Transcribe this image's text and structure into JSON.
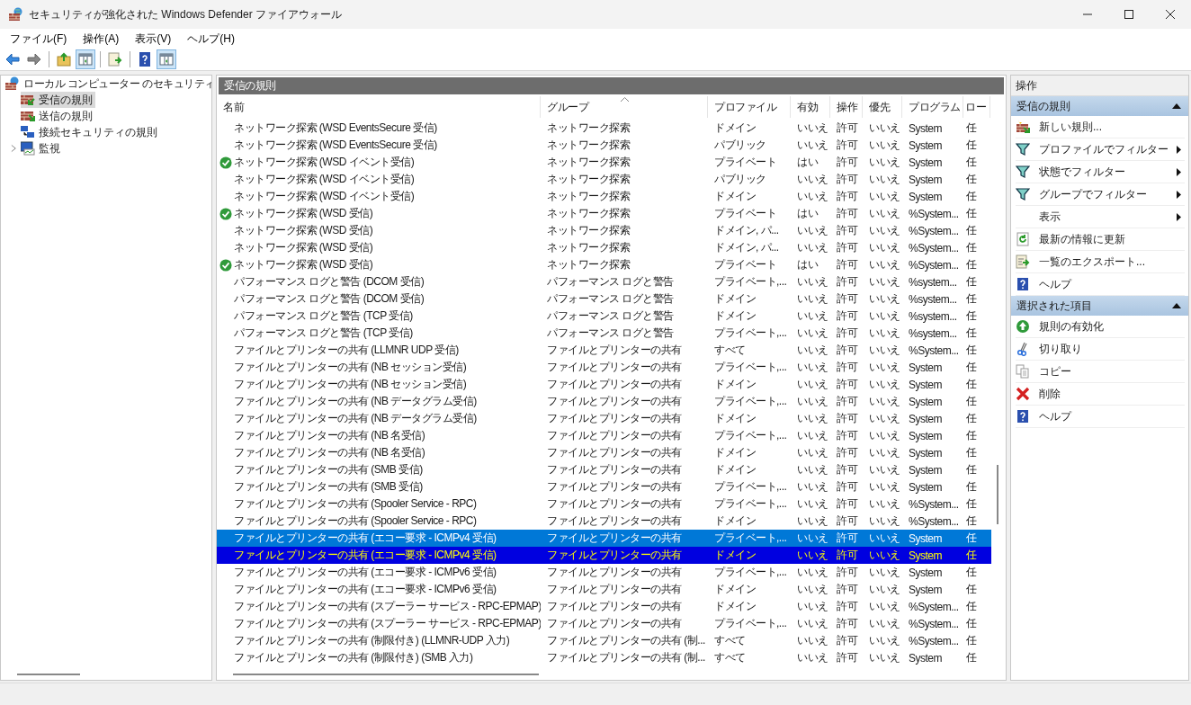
{
  "window": {
    "title": "セキュリティが強化された Windows Defender ファイアウォール"
  },
  "menu": [
    "ファイル(F)",
    "操作(A)",
    "表示(V)",
    "ヘルプ(H)"
  ],
  "toolbar": [
    {
      "kind": "back",
      "pressed": false
    },
    {
      "kind": "forward",
      "pressed": false
    },
    {
      "kind": "sep",
      "pressed": false
    },
    {
      "kind": "up",
      "pressed": false
    },
    {
      "kind": "tree",
      "pressed": true
    },
    {
      "kind": "sep",
      "pressed": false
    },
    {
      "kind": "export",
      "pressed": false
    },
    {
      "kind": "sep",
      "pressed": false
    },
    {
      "kind": "help",
      "pressed": false
    },
    {
      "kind": "pane",
      "pressed": true
    }
  ],
  "tree": {
    "root": "ローカル コンピューター のセキュリティ",
    "children": [
      {
        "label": "受信の規則",
        "kind": "inbound",
        "selected": true,
        "expandable": false
      },
      {
        "label": "送信の規則",
        "kind": "outbound",
        "selected": false,
        "expandable": false
      },
      {
        "label": "接続セキュリティの規則",
        "kind": "connection",
        "selected": false,
        "expandable": false
      },
      {
        "label": "監視",
        "kind": "monitor",
        "selected": false,
        "expandable": true
      }
    ]
  },
  "center": {
    "title": "受信の規則",
    "columns": [
      {
        "label": "名前",
        "sorted": false
      },
      {
        "label": "グループ",
        "sorted": true
      },
      {
        "label": "プロファイル",
        "sorted": false
      },
      {
        "label": "有効",
        "sorted": false
      },
      {
        "label": "操作",
        "sorted": false
      },
      {
        "label": "優先",
        "sorted": false
      },
      {
        "label": "プログラム",
        "sorted": false
      },
      {
        "label": "ロー",
        "sorted": false
      }
    ],
    "rows": [
      {
        "active": false,
        "selected": false,
        "focused": false,
        "cells": [
          "ネットワーク探索 (WSD EventsSecure 受信)",
          "ネットワーク探索",
          "ドメイン",
          "いいえ",
          "許可",
          "いいえ",
          "System",
          "任"
        ]
      },
      {
        "active": false,
        "selected": false,
        "focused": false,
        "cells": [
          "ネットワーク探索 (WSD EventsSecure 受信)",
          "ネットワーク探索",
          "パブリック",
          "いいえ",
          "許可",
          "いいえ",
          "System",
          "任"
        ]
      },
      {
        "active": true,
        "selected": false,
        "focused": false,
        "cells": [
          "ネットワーク探索 (WSD イベント受信)",
          "ネットワーク探索",
          "プライベート",
          "はい",
          "許可",
          "いいえ",
          "System",
          "任"
        ]
      },
      {
        "active": false,
        "selected": false,
        "focused": false,
        "cells": [
          "ネットワーク探索 (WSD イベント受信)",
          "ネットワーク探索",
          "パブリック",
          "いいえ",
          "許可",
          "いいえ",
          "System",
          "任"
        ]
      },
      {
        "active": false,
        "selected": false,
        "focused": false,
        "cells": [
          "ネットワーク探索 (WSD イベント受信)",
          "ネットワーク探索",
          "ドメイン",
          "いいえ",
          "許可",
          "いいえ",
          "System",
          "任"
        ]
      },
      {
        "active": true,
        "selected": false,
        "focused": false,
        "cells": [
          "ネットワーク探索 (WSD 受信)",
          "ネットワーク探索",
          "プライベート",
          "はい",
          "許可",
          "いいえ",
          "%System...",
          "任"
        ]
      },
      {
        "active": false,
        "selected": false,
        "focused": false,
        "cells": [
          "ネットワーク探索 (WSD 受信)",
          "ネットワーク探索",
          "ドメイン, パ...",
          "いいえ",
          "許可",
          "いいえ",
          "%System...",
          "任"
        ]
      },
      {
        "active": false,
        "selected": false,
        "focused": false,
        "cells": [
          "ネットワーク探索 (WSD 受信)",
          "ネットワーク探索",
          "ドメイン, パ...",
          "いいえ",
          "許可",
          "いいえ",
          "%System...",
          "任"
        ]
      },
      {
        "active": true,
        "selected": false,
        "focused": false,
        "cells": [
          "ネットワーク探索 (WSD 受信)",
          "ネットワーク探索",
          "プライベート",
          "はい",
          "許可",
          "いいえ",
          "%System...",
          "任"
        ]
      },
      {
        "active": false,
        "selected": false,
        "focused": false,
        "cells": [
          "パフォーマンス ログと警告 (DCOM 受信)",
          "パフォーマンス ログと警告",
          "プライベート,...",
          "いいえ",
          "許可",
          "いいえ",
          "%system...",
          "任"
        ]
      },
      {
        "active": false,
        "selected": false,
        "focused": false,
        "cells": [
          "パフォーマンス ログと警告 (DCOM 受信)",
          "パフォーマンス ログと警告",
          "ドメイン",
          "いいえ",
          "許可",
          "いいえ",
          "%system...",
          "任"
        ]
      },
      {
        "active": false,
        "selected": false,
        "focused": false,
        "cells": [
          "パフォーマンス ログと警告 (TCP 受信)",
          "パフォーマンス ログと警告",
          "ドメイン",
          "いいえ",
          "許可",
          "いいえ",
          "%system...",
          "任"
        ]
      },
      {
        "active": false,
        "selected": false,
        "focused": false,
        "cells": [
          "パフォーマンス ログと警告 (TCP 受信)",
          "パフォーマンス ログと警告",
          "プライベート,...",
          "いいえ",
          "許可",
          "いいえ",
          "%system...",
          "任"
        ]
      },
      {
        "active": false,
        "selected": false,
        "focused": false,
        "cells": [
          "ファイルとプリンターの共有 (LLMNR UDP 受信)",
          "ファイルとプリンターの共有",
          "すべて",
          "いいえ",
          "許可",
          "いいえ",
          "%System...",
          "任"
        ]
      },
      {
        "active": false,
        "selected": false,
        "focused": false,
        "cells": [
          "ファイルとプリンターの共有 (NB セッション受信)",
          "ファイルとプリンターの共有",
          "プライベート,...",
          "いいえ",
          "許可",
          "いいえ",
          "System",
          "任"
        ]
      },
      {
        "active": false,
        "selected": false,
        "focused": false,
        "cells": [
          "ファイルとプリンターの共有 (NB セッション受信)",
          "ファイルとプリンターの共有",
          "ドメイン",
          "いいえ",
          "許可",
          "いいえ",
          "System",
          "任"
        ]
      },
      {
        "active": false,
        "selected": false,
        "focused": false,
        "cells": [
          "ファイルとプリンターの共有 (NB データグラム受信)",
          "ファイルとプリンターの共有",
          "プライベート,...",
          "いいえ",
          "許可",
          "いいえ",
          "System",
          "任"
        ]
      },
      {
        "active": false,
        "selected": false,
        "focused": false,
        "cells": [
          "ファイルとプリンターの共有 (NB データグラム受信)",
          "ファイルとプリンターの共有",
          "ドメイン",
          "いいえ",
          "許可",
          "いいえ",
          "System",
          "任"
        ]
      },
      {
        "active": false,
        "selected": false,
        "focused": false,
        "cells": [
          "ファイルとプリンターの共有 (NB 名受信)",
          "ファイルとプリンターの共有",
          "プライベート,...",
          "いいえ",
          "許可",
          "いいえ",
          "System",
          "任"
        ]
      },
      {
        "active": false,
        "selected": false,
        "focused": false,
        "cells": [
          "ファイルとプリンターの共有 (NB 名受信)",
          "ファイルとプリンターの共有",
          "ドメイン",
          "いいえ",
          "許可",
          "いいえ",
          "System",
          "任"
        ]
      },
      {
        "active": false,
        "selected": false,
        "focused": false,
        "cells": [
          "ファイルとプリンターの共有 (SMB 受信)",
          "ファイルとプリンターの共有",
          "ドメイン",
          "いいえ",
          "許可",
          "いいえ",
          "System",
          "任"
        ]
      },
      {
        "active": false,
        "selected": false,
        "focused": false,
        "cells": [
          "ファイルとプリンターの共有 (SMB 受信)",
          "ファイルとプリンターの共有",
          "プライベート,...",
          "いいえ",
          "許可",
          "いいえ",
          "System",
          "任"
        ]
      },
      {
        "active": false,
        "selected": false,
        "focused": false,
        "cells": [
          "ファイルとプリンターの共有 (Spooler Service - RPC)",
          "ファイルとプリンターの共有",
          "プライベート,...",
          "いいえ",
          "許可",
          "いいえ",
          "%System...",
          "任"
        ]
      },
      {
        "active": false,
        "selected": false,
        "focused": false,
        "cells": [
          "ファイルとプリンターの共有 (Spooler Service - RPC)",
          "ファイルとプリンターの共有",
          "ドメイン",
          "いいえ",
          "許可",
          "いいえ",
          "%System...",
          "任"
        ]
      },
      {
        "active": false,
        "selected": true,
        "focused": false,
        "cells": [
          "ファイルとプリンターの共有 (エコー要求 - ICMPv4 受信)",
          "ファイルとプリンターの共有",
          "プライベート,...",
          "いいえ",
          "許可",
          "いいえ",
          "System",
          "任"
        ]
      },
      {
        "active": false,
        "selected": true,
        "focused": true,
        "cells": [
          "ファイルとプリンターの共有 (エコー要求 - ICMPv4 受信)",
          "ファイルとプリンターの共有",
          "ドメイン",
          "いいえ",
          "許可",
          "いいえ",
          "System",
          "任"
        ]
      },
      {
        "active": false,
        "selected": false,
        "focused": false,
        "cells": [
          "ファイルとプリンターの共有 (エコー要求 - ICMPv6 受信)",
          "ファイルとプリンターの共有",
          "プライベート,...",
          "いいえ",
          "許可",
          "いいえ",
          "System",
          "任"
        ]
      },
      {
        "active": false,
        "selected": false,
        "focused": false,
        "cells": [
          "ファイルとプリンターの共有 (エコー要求 - ICMPv6 受信)",
          "ファイルとプリンターの共有",
          "ドメイン",
          "いいえ",
          "許可",
          "いいえ",
          "System",
          "任"
        ]
      },
      {
        "active": false,
        "selected": false,
        "focused": false,
        "cells": [
          "ファイルとプリンターの共有 (スプーラー サービス - RPC-EPMAP)",
          "ファイルとプリンターの共有",
          "ドメイン",
          "いいえ",
          "許可",
          "いいえ",
          "%System...",
          "任"
        ]
      },
      {
        "active": false,
        "selected": false,
        "focused": false,
        "cells": [
          "ファイルとプリンターの共有 (スプーラー サービス - RPC-EPMAP)",
          "ファイルとプリンターの共有",
          "プライベート,...",
          "いいえ",
          "許可",
          "いいえ",
          "%System...",
          "任"
        ]
      },
      {
        "active": false,
        "selected": false,
        "focused": false,
        "cells": [
          "ファイルとプリンターの共有 (制限付き) (LLMNR-UDP 入力)",
          "ファイルとプリンターの共有 (制...",
          "すべて",
          "いいえ",
          "許可",
          "いいえ",
          "%System...",
          "任"
        ]
      },
      {
        "active": false,
        "selected": false,
        "focused": false,
        "cells": [
          "ファイルとプリンターの共有 (制限付き) (SMB 入力)",
          "ファイルとプリンターの共有 (制...",
          "すべて",
          "いいえ",
          "許可",
          "いいえ",
          "System",
          "任"
        ]
      }
    ]
  },
  "actions": {
    "title": "操作",
    "sections": [
      {
        "title": "受信の規則",
        "expanded": true,
        "items": [
          {
            "label": "新しい規則...",
            "kind": "new-rule",
            "submenu": false
          },
          {
            "label": "プロファイルでフィルター",
            "kind": "filter",
            "submenu": true
          },
          {
            "label": "状態でフィルター",
            "kind": "filter",
            "submenu": true
          },
          {
            "label": "グループでフィルター",
            "kind": "filter",
            "submenu": true
          },
          {
            "label": "表示",
            "kind": "none",
            "submenu": true
          },
          {
            "label": "最新の情報に更新",
            "kind": "refresh",
            "submenu": false
          },
          {
            "label": "一覧のエクスポート...",
            "kind": "export",
            "submenu": false
          },
          {
            "label": "ヘルプ",
            "kind": "help",
            "submenu": false
          }
        ]
      },
      {
        "title": "選択された項目",
        "expanded": true,
        "items": [
          {
            "label": "規則の有効化",
            "kind": "enable",
            "submenu": false
          },
          {
            "label": "切り取り",
            "kind": "cut",
            "submenu": false
          },
          {
            "label": "コピー",
            "kind": "copy",
            "submenu": false
          },
          {
            "label": "削除",
            "kind": "delete",
            "submenu": false
          },
          {
            "label": "ヘルプ",
            "kind": "help",
            "submenu": false
          }
        ]
      }
    ]
  }
}
